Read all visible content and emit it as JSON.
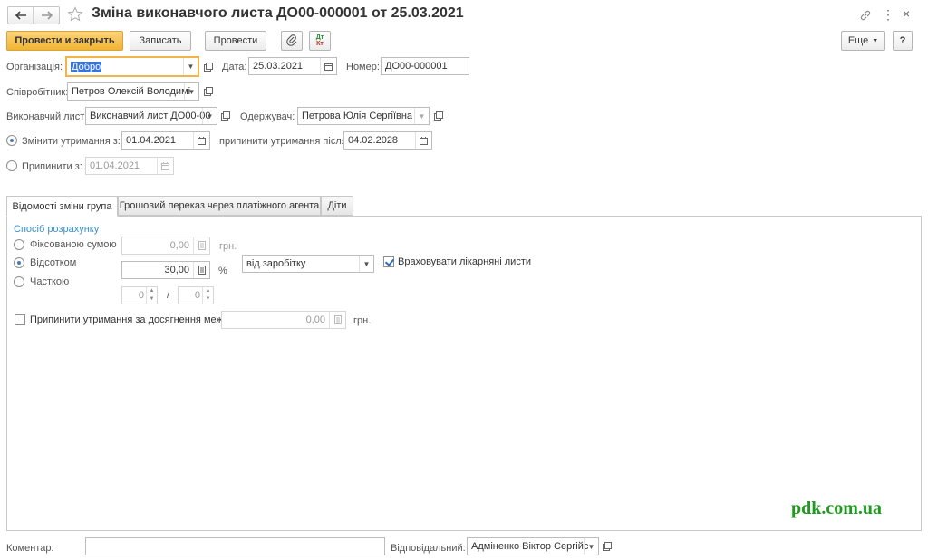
{
  "window": {
    "title": "Зміна виконавчого листа ДО00-000001 от 25.03.2021"
  },
  "toolbar": {
    "post_close": "Провести и закрыть",
    "save": "Записать",
    "post": "Провести",
    "more": "Еще",
    "help": "?"
  },
  "header": {
    "org_label": "Організація:",
    "org_value": "Добро",
    "date_label": "Дата:",
    "date_value": "25.03.2021",
    "number_label": "Номер:",
    "number_value": "ДО00-000001",
    "employee_label": "Співробітник:",
    "employee_value": "Петров Олексій Володимі",
    "writ_label": "Виконавчий лист:",
    "writ_value": "Виконавчий лист ДО00-00",
    "recipient_label": "Одержувач:",
    "recipient_value": "Петрова Юлія Сергіївна",
    "change_from_label": "Змінити утримання з:",
    "change_from_value": "01.04.2021",
    "stop_after_label": "припинити утримання після:",
    "stop_after_value": "04.02.2028",
    "stop_from_label": "Припинити з:",
    "stop_from_value": "01.04.2021"
  },
  "tabs": [
    "Відомості зміни група",
    "Грошовий переказ через платіжного агента",
    "Діти"
  ],
  "calc": {
    "section_title": "Спосіб розрахунку",
    "fixed_label": "Фіксованою сумою",
    "fixed_value": "0,00",
    "currency": "грн.",
    "percent_label": "Відсотком",
    "percent_value": "30,00",
    "percent_unit": "%",
    "base_value": "від заробітку",
    "sick_leave_label": "Враховувати лікарняні листи",
    "share_label": "Часткою",
    "share_num": "0",
    "share_sep": "/",
    "share_den": "0",
    "limit_label": "Припинити утримання за досягнення межі",
    "limit_value": "0,00",
    "limit_currency": "грн."
  },
  "footer": {
    "comment_label": "Коментар:",
    "comment_value": "",
    "responsible_label": "Відповідальний:",
    "responsible_value": "Адміненко Віктор Сергійс"
  },
  "watermark": "pdk.com.ua",
  "colors": {
    "primary_button": "#f1b433",
    "org_field_border": "#f0b44a",
    "section_title": "#3a8fc9",
    "watermark": "#1e9b1e"
  }
}
